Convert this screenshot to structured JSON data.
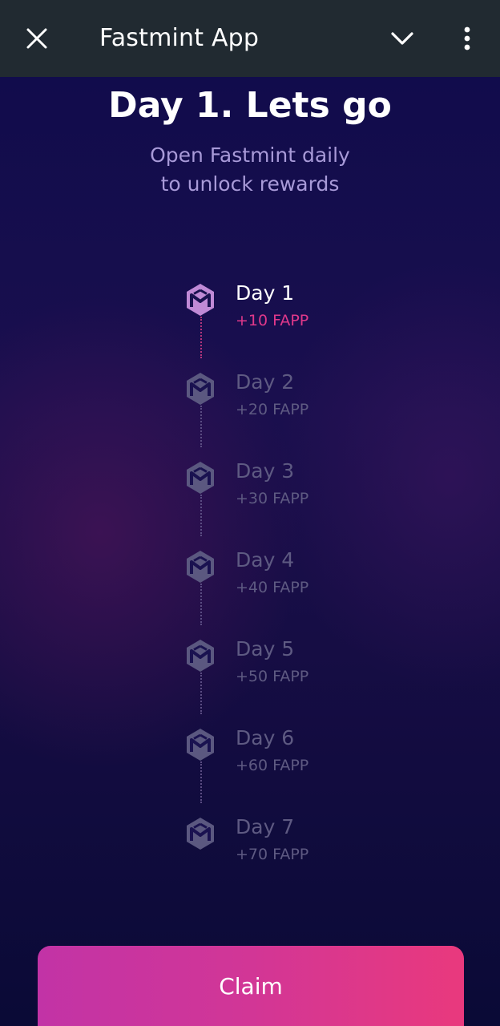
{
  "topbar": {
    "title": "Fastmint App",
    "close_icon": "close-icon",
    "chevron_icon": "chevron-down-icon",
    "more_icon": "more-vert-icon"
  },
  "header": {
    "headline": "Day 1. Lets go",
    "subline_1": "Open Fastmint daily",
    "subline_2": "to unlock rewards"
  },
  "days": [
    {
      "label": "Day 1",
      "reward": "+10 FAPP",
      "active": true
    },
    {
      "label": "Day 2",
      "reward": "+20 FAPP",
      "active": false
    },
    {
      "label": "Day 3",
      "reward": "+30 FAPP",
      "active": false
    },
    {
      "label": "Day 4",
      "reward": "+40 FAPP",
      "active": false
    },
    {
      "label": "Day 5",
      "reward": "+50 FAPP",
      "active": false
    },
    {
      "label": "Day 6",
      "reward": "+60 FAPP",
      "active": false
    },
    {
      "label": "Day 7",
      "reward": "+70 FAPP",
      "active": false
    }
  ],
  "claim": {
    "label": "Claim"
  },
  "colors": {
    "topbar": "#212a31",
    "accent_pink": "#e0388a",
    "active_icon": "#c08ad6",
    "inactive_icon": "#5b5880"
  }
}
